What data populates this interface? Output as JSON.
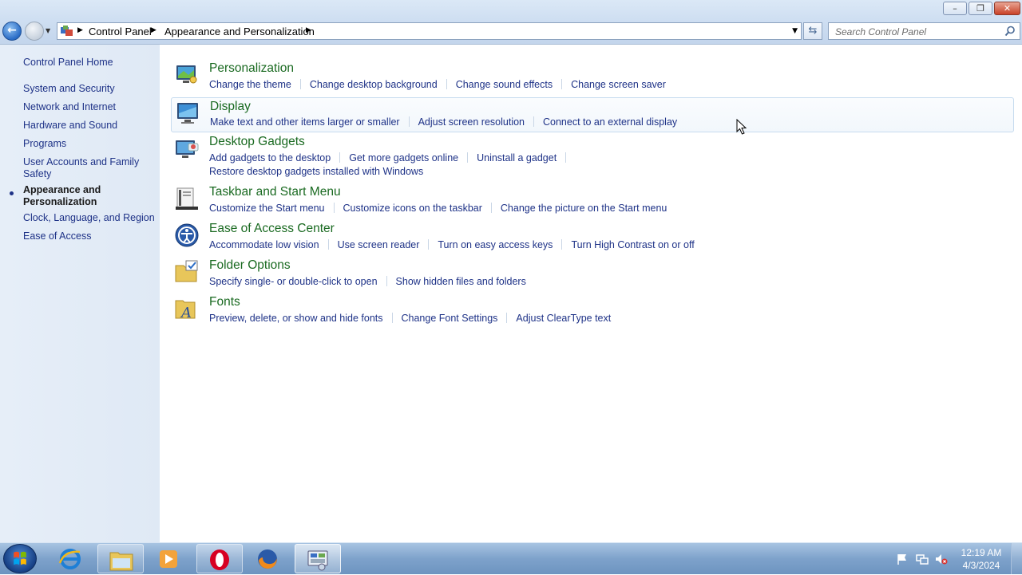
{
  "window": {
    "buttons": {
      "minimize": "–",
      "maximize": "❐",
      "close": "✕"
    }
  },
  "address_bar": {
    "breadcrumbs": [
      "Control Panel",
      "Appearance and Personalization"
    ],
    "search_placeholder": "Search Control Panel"
  },
  "left_pane": {
    "home": "Control Panel Home",
    "items": [
      "System and Security",
      "Network and Internet",
      "Hardware and Sound",
      "Programs",
      "User Accounts and Family Safety",
      "Appearance and Personalization",
      "Clock, Language, and Region",
      "Ease of Access"
    ],
    "current_item": "Appearance and Personalization"
  },
  "categories": [
    {
      "title": "Personalization",
      "icon": "personalization-icon",
      "tasks": [
        "Change the theme",
        "Change desktop background",
        "Change sound effects",
        "Change screen saver"
      ]
    },
    {
      "title": "Display",
      "icon": "display-icon",
      "tasks": [
        "Make text and other items larger or smaller",
        "Adjust screen resolution",
        "Connect to an external display"
      ]
    },
    {
      "title": "Desktop Gadgets",
      "icon": "gadgets-icon",
      "tasks": [
        "Add gadgets to the desktop",
        "Get more gadgets online",
        "Uninstall a gadget"
      ],
      "tasks_line2": [
        "Restore desktop gadgets installed with Windows"
      ]
    },
    {
      "title": "Taskbar and Start Menu",
      "icon": "taskbar-icon",
      "tasks": [
        "Customize the Start menu",
        "Customize icons on the taskbar",
        "Change the picture on the Start menu"
      ]
    },
    {
      "title": "Ease of Access Center",
      "icon": "ease-of-access-icon",
      "tasks": [
        "Accommodate low vision",
        "Use screen reader",
        "Turn on easy access keys",
        "Turn High Contrast on or off"
      ]
    },
    {
      "title": "Folder Options",
      "icon": "folder-options-icon",
      "tasks": [
        "Specify single- or double-click to open",
        "Show hidden files and folders"
      ]
    },
    {
      "title": "Fonts",
      "icon": "fonts-icon",
      "tasks": [
        "Preview, delete, or show and hide fonts",
        "Change Font Settings",
        "Adjust ClearType text"
      ]
    }
  ],
  "taskbar": {
    "apps": [
      "internet-explorer-icon",
      "windows-explorer-icon",
      "media-player-icon",
      "opera-icon",
      "firefox-icon",
      "control-panel-icon"
    ],
    "tray_icons": [
      "action-center-flag-icon",
      "network-icon",
      "volume-muted-icon"
    ],
    "time": "12:19 AM",
    "date": "4/3/2024"
  },
  "colors": {
    "link": "#1e3287",
    "category_title": "#1a6a21",
    "left_pane_bg": "#e4edf8",
    "taskbar": "#7ea2cb"
  }
}
